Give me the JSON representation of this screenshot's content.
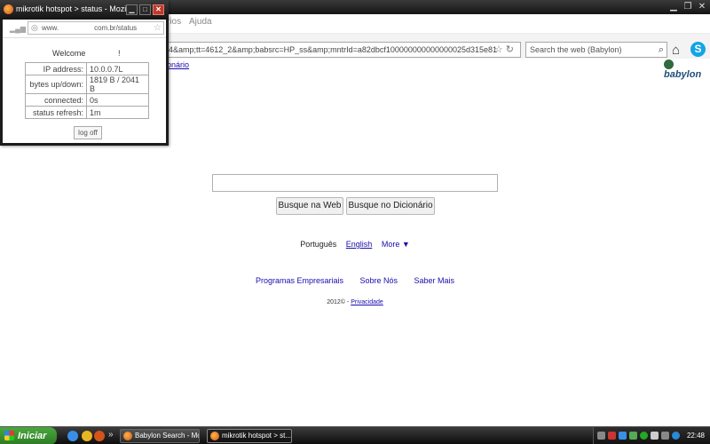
{
  "main_window": {
    "title": "Babylon Search - Mozilla Firefox",
    "menus": [
      "rios",
      "Ajuda"
    ],
    "url": "4&amp;tt=4612_2&amp;babsrc=HP_ss&amp;mntrId=a82dbcf100000000000000025d315e81",
    "search_placeholder": "Search the web (Babylon)",
    "bookmark_link": "onário",
    "logo_text": "babylon"
  },
  "page": {
    "search_value": "",
    "btn_web": "Busque na Web",
    "btn_dict": "Busque no Dicionário",
    "languages": [
      "Português",
      "English"
    ],
    "more_label": "More ▼",
    "footer_links": [
      "Programas Empresariais",
      "Sobre Nós",
      "Saber Mais"
    ],
    "copyright": "2012© - ",
    "privacy": "Privacidade"
  },
  "popup": {
    "title": "mikrotik hotspot > status - Mozilla ...",
    "url_prefix": "www.",
    "url_suffix": "com.br/status",
    "welcome": "Welcome",
    "welcome_name": "!",
    "rows": [
      {
        "label": "IP address:",
        "value": "10.0.0.7L"
      },
      {
        "label": "bytes up/down:",
        "value": "1819 B / 2041 B"
      },
      {
        "label": "connected:",
        "value": "0s"
      },
      {
        "label": "status refresh:",
        "value": "1m"
      }
    ],
    "logoff": "log off"
  },
  "taskbar": {
    "start": "Iniciar",
    "chevron": "»",
    "tasks": [
      "Babylon Search - Moz...",
      "mikrotik hotspot > st..."
    ],
    "clock": "22:48"
  }
}
